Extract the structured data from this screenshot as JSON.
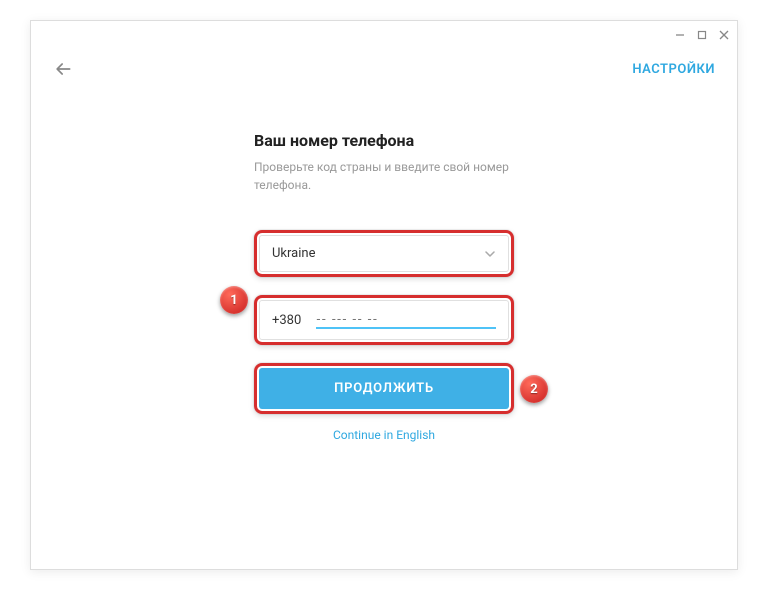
{
  "topbar": {
    "settings": "НАСТРОЙКИ"
  },
  "form": {
    "title": "Ваш номер телефона",
    "subtitle": "Проверьте код страны и введите свой номер телефона.",
    "country": "Ukraine",
    "dialcode": "+380",
    "phone_placeholder": "-- --- -- --",
    "continue": "ПРОДОЛЖИТЬ",
    "lang_switch": "Continue in English"
  },
  "markers": {
    "one": "1",
    "two": "2"
  }
}
